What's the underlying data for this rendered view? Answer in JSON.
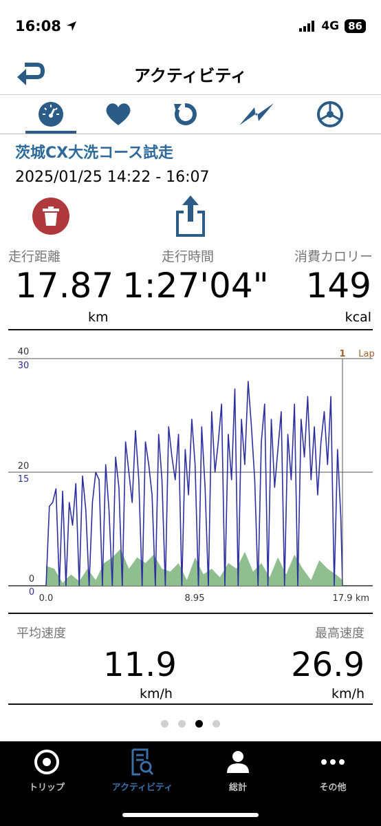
{
  "status_bar": {
    "time": "16:08",
    "network": "4G",
    "battery": "86"
  },
  "header": {
    "title": "アクティビティ",
    "back_icon": "back-arrow-icon"
  },
  "icon_tabs": [
    {
      "icon": "speedometer-icon",
      "active": true
    },
    {
      "icon": "heart-icon",
      "active": false
    },
    {
      "icon": "refresh-icon",
      "active": false
    },
    {
      "icon": "lightning-icon",
      "active": false
    },
    {
      "icon": "gear-icon",
      "active": false
    }
  ],
  "activity": {
    "title": "茨城CX大洗コース試走",
    "date_range": "2025/01/25 14:22 - 16:07"
  },
  "actions": {
    "delete_icon": "trash-icon",
    "share_icon": "share-icon"
  },
  "stats": {
    "distance": {
      "label": "走行距離",
      "value": "17.87",
      "unit": "km"
    },
    "time": {
      "label": "走行時間",
      "value": "1:27'04\""
    },
    "calories": {
      "label": "消費カロリー",
      "value": "149",
      "unit": "kcal"
    }
  },
  "chart_data": {
    "type": "line",
    "x_ticks": [
      "0.0",
      "8.95",
      "17.9"
    ],
    "x_unit": "km",
    "xlim": [
      0,
      17.9
    ],
    "left_ticks": [
      "40",
      "20",
      "0"
    ],
    "speed_ticks": [
      "30",
      "15",
      "0"
    ],
    "speed_ylim": [
      0,
      30
    ],
    "elevation_ylim": [
      0,
      40
    ],
    "lap_marker": {
      "label": "1",
      "text": "Lap",
      "x": 17.9
    },
    "series": [
      {
        "role": "speed",
        "color": "#2d2fa0",
        "x": [
          0,
          0.2,
          0.4,
          0.6,
          0.8,
          1,
          1.2,
          1.4,
          1.6,
          1.8,
          2,
          2.2,
          2.4,
          2.6,
          2.8,
          3,
          3.2,
          3.4,
          3.6,
          3.8,
          4,
          4.2,
          4.4,
          4.6,
          4.8,
          5,
          5.2,
          5.4,
          5.6,
          5.8,
          6,
          6.2,
          6.4,
          6.6,
          6.8,
          7,
          7.2,
          7.4,
          7.6,
          7.8,
          8,
          8.2,
          8.4,
          8.6,
          8.8,
          9,
          9.2,
          9.4,
          9.6,
          9.8,
          10,
          10.2,
          10.4,
          10.6,
          10.8,
          11,
          11.2,
          11.4,
          11.6,
          11.8,
          12,
          12.2,
          12.4,
          12.6,
          12.8,
          13,
          13.2,
          13.4,
          13.6,
          13.8,
          14,
          14.2,
          14.4,
          14.6,
          14.8,
          15,
          15.2,
          15.4,
          15.6,
          15.8,
          16,
          16.2,
          16.4,
          16.6,
          16.8,
          17,
          17.2,
          17.4,
          17.6,
          17.8,
          17.9
        ],
        "values": [
          0,
          10.5,
          11,
          12.8,
          0,
          12.5,
          0,
          11,
          8,
          13.5,
          0,
          14.5,
          10,
          0,
          11,
          15,
          14,
          0,
          16,
          10,
          0,
          17,
          13,
          0,
          19,
          15,
          11,
          20.5,
          14,
          0,
          19,
          16,
          12,
          0,
          20,
          14,
          0,
          21,
          17,
          14,
          20,
          0,
          18,
          12,
          22,
          16,
          0,
          21,
          13,
          0,
          23,
          15,
          19,
          24,
          0,
          20,
          14,
          26,
          0,
          22,
          16,
          27,
          21,
          14,
          0,
          19,
          24,
          0,
          22,
          13,
          18,
          23,
          0,
          20,
          14,
          24,
          0,
          22,
          17,
          25,
          14,
          21,
          12,
          19,
          23,
          16,
          25,
          0,
          18,
          9,
          0
        ]
      },
      {
        "role": "elevation",
        "color": "#8fbf8f",
        "x": [
          0,
          0.5,
          1,
          1.5,
          2,
          2.5,
          3,
          3.5,
          4,
          4.5,
          5,
          5.5,
          6,
          6.5,
          7,
          7.5,
          8,
          8.5,
          9,
          9.5,
          10,
          10.5,
          11,
          11.5,
          12,
          12.5,
          13,
          13.5,
          14,
          14.5,
          15,
          15.5,
          16,
          16.5,
          17,
          17.5,
          17.9
        ],
        "values": [
          3.5,
          3,
          0.5,
          2,
          0.8,
          3,
          1,
          4,
          5,
          6.5,
          3,
          5,
          4,
          5.5,
          3,
          2.5,
          4,
          1,
          5,
          2,
          3,
          1.5,
          4,
          3,
          6,
          2.5,
          4,
          1.5,
          5,
          2,
          5.5,
          3,
          1,
          4.5,
          3,
          2,
          1
        ]
      }
    ]
  },
  "speeds": {
    "average": {
      "label": "平均速度",
      "value": "11.9",
      "unit": "km/h"
    },
    "max": {
      "label": "最高速度",
      "value": "26.9",
      "unit": "km/h"
    }
  },
  "pager": {
    "count": 4,
    "active_index": 2
  },
  "bottom_nav": [
    {
      "label": "トリップ",
      "icon": "target-icon",
      "active": false
    },
    {
      "label": "アクティビティ",
      "icon": "activity-search-icon",
      "active": true
    },
    {
      "label": "総計",
      "icon": "person-icon",
      "active": false
    },
    {
      "label": "その他",
      "icon": "more-icon",
      "active": false
    }
  ],
  "colors": {
    "accent": "#2a5c87",
    "title_blue": "#2d6a9a",
    "delete_red": "#b0393e",
    "lap_brown": "#a0602a"
  }
}
